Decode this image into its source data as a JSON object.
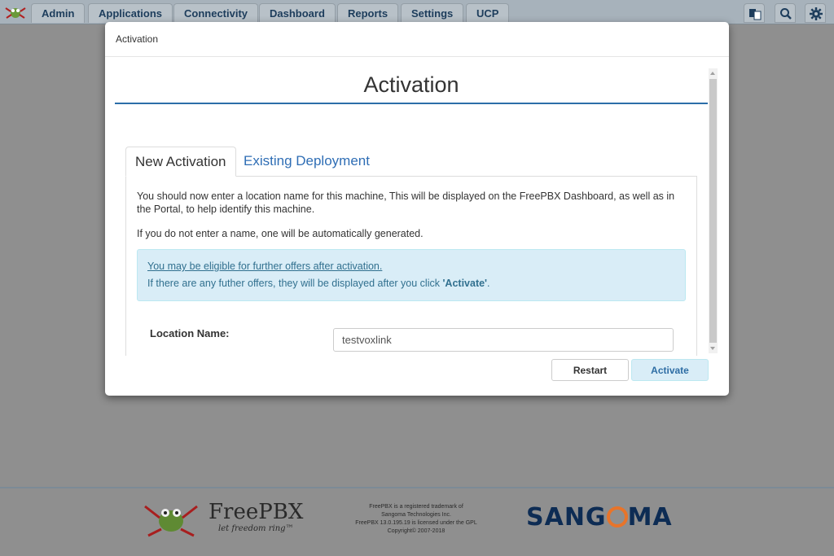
{
  "navbar": {
    "items": [
      {
        "label": "Admin"
      },
      {
        "label": "Applications"
      },
      {
        "label": "Connectivity"
      },
      {
        "label": "Dashboard"
      },
      {
        "label": "Reports"
      },
      {
        "label": "Settings"
      },
      {
        "label": "UCP"
      }
    ],
    "icons": [
      "language-icon",
      "search-icon",
      "gear-icon"
    ]
  },
  "modal": {
    "header": "Activation",
    "title": "Activation",
    "tabs": [
      {
        "label": "New Activation"
      },
      {
        "label": "Existing Deployment"
      }
    ],
    "intro": "You should now enter a location name for this machine, This will be displayed on the FreePBX Dashboard, as well as in the Portal, to help identify this machine.",
    "note": "If you do not enter a name, one will be automatically generated.",
    "alert": {
      "link": "You may be eligible for further offers after activation.",
      "text_before": "If there are any futher offers, they will be displayed after you click ",
      "text_bold": "'Activate'",
      "text_after": "."
    },
    "location_label": "Location Name:",
    "location_value": "testvoxlink",
    "buttons": {
      "restart": "Restart",
      "activate": "Activate"
    }
  },
  "footer": {
    "freepbx_name": "FreePBX",
    "freepbx_tagline": "let freedom ring™",
    "legal_lines": [
      "FreePBX is a registered trademark of",
      "Sangoma Technologies Inc.",
      "FreePBX 13.0.195.19 is licensed under the GPL",
      "Copyright© 2007-2018"
    ],
    "sangoma_logo": "SANGOMA"
  },
  "colors": {
    "navbar": "#a7b2bb",
    "overlay": "#8f8f8f",
    "accent": "#2b6ea8",
    "alert_bg": "#d9edf7",
    "sangoma_blue": "#0d2c54",
    "sangoma_orange": "#e8742a"
  }
}
